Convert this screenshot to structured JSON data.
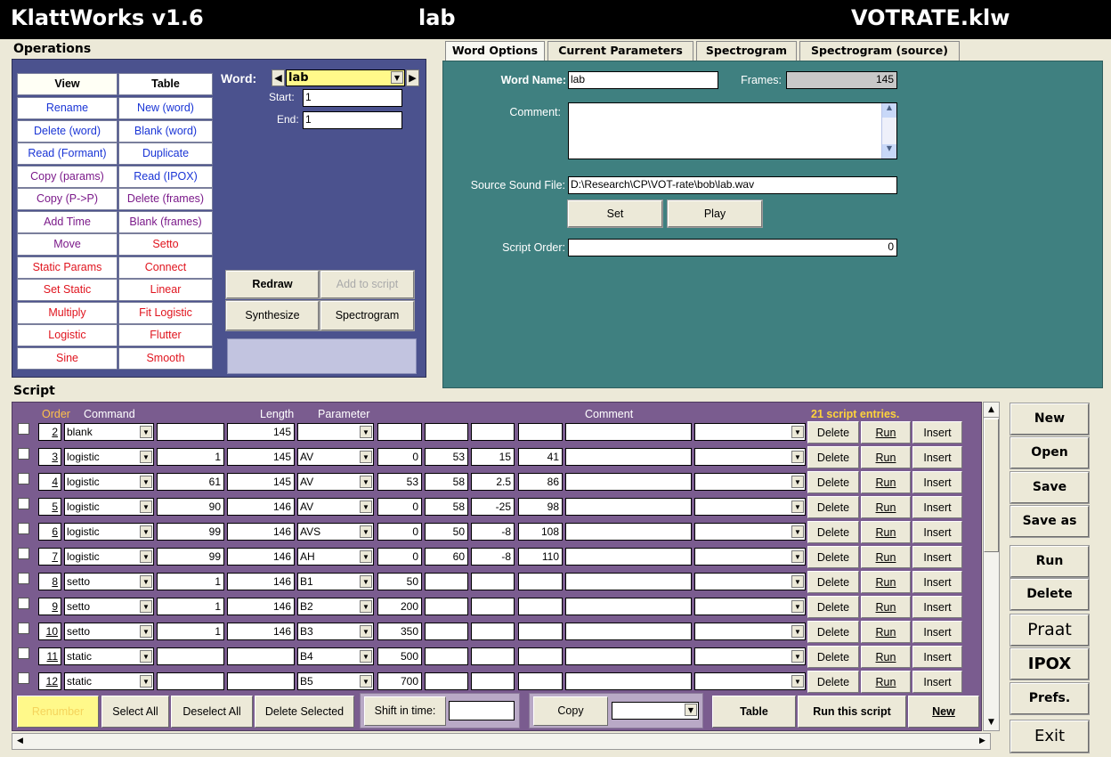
{
  "title": {
    "app": "KlattWorks v1.6",
    "word": "lab",
    "file": "VOTRATE.klw"
  },
  "operations": {
    "heading": "Operations",
    "col_headers": [
      "View",
      "Table"
    ],
    "left_buttons": [
      {
        "label": "Rename",
        "color": "blue"
      },
      {
        "label": "Delete (word)",
        "color": "blue"
      },
      {
        "label": "Read (Formant)",
        "color": "blue"
      },
      {
        "label": "Copy (params)",
        "color": "purple"
      },
      {
        "label": "Copy (P->P)",
        "color": "purple"
      },
      {
        "label": "Add Time",
        "color": "purple"
      },
      {
        "label": "Move",
        "color": "purple"
      },
      {
        "label": "Static Params",
        "color": "red"
      },
      {
        "label": "Set Static",
        "color": "red"
      },
      {
        "label": "Multiply",
        "color": "red"
      },
      {
        "label": "Logistic",
        "color": "red"
      },
      {
        "label": "Sine",
        "color": "red"
      }
    ],
    "right_buttons": [
      {
        "label": "New (word)",
        "color": "blue"
      },
      {
        "label": "Blank (word)",
        "color": "blue"
      },
      {
        "label": "Duplicate",
        "color": "blue"
      },
      {
        "label": "Read (IPOX)",
        "color": "blue"
      },
      {
        "label": "Delete (frames)",
        "color": "purple"
      },
      {
        "label": "Blank (frames)",
        "color": "purple"
      },
      {
        "label": "Setto",
        "color": "red"
      },
      {
        "label": "Connect",
        "color": "red"
      },
      {
        "label": "Linear",
        "color": "red"
      },
      {
        "label": "Fit Logistic",
        "color": "red"
      },
      {
        "label": "Flutter",
        "color": "red"
      },
      {
        "label": "Smooth",
        "color": "red"
      }
    ],
    "word_label": "Word:",
    "word_value": "lab",
    "start_label": "Start:",
    "start_value": "1",
    "end_label": "End:",
    "end_value": "1",
    "redraw": "Redraw",
    "add_to_script": "Add to script",
    "synthesize": "Synthesize",
    "spectrogram": "Spectrogram"
  },
  "tabs": [
    "Word Options",
    "Current Parameters",
    "Spectrogram",
    "Spectrogram (source)"
  ],
  "word_options": {
    "word_name_label": "Word Name:",
    "word_name_value": "lab",
    "frames_label": "Frames:",
    "frames_value": "145",
    "comment_label": "Comment:",
    "comment_value": "",
    "source_label": "Source Sound File:",
    "source_value": "D:\\Research\\CP\\VOT-rate\\bob\\lab.wav",
    "set_label": "Set",
    "play_label": "Play",
    "script_order_label": "Script Order:",
    "script_order_value": "0"
  },
  "script": {
    "heading": "Script",
    "headers": {
      "order": "Order",
      "command": "Command",
      "length": "Length",
      "parameter": "Parameter",
      "comment": "Comment"
    },
    "entries_count": "21 script entries.",
    "row_buttons": {
      "delete": "Delete",
      "run": "Run",
      "insert": "Insert"
    },
    "rows": [
      {
        "order": "2",
        "command": "blank",
        "a": "",
        "length": "145",
        "param": "",
        "v1": "",
        "v2": "",
        "v3": "",
        "v4": ""
      },
      {
        "order": "3",
        "command": "logistic",
        "a": "1",
        "length": "145",
        "param": "AV",
        "v1": "0",
        "v2": "53",
        "v3": "15",
        "v4": "41"
      },
      {
        "order": "4",
        "command": "logistic",
        "a": "61",
        "length": "145",
        "param": "AV",
        "v1": "53",
        "v2": "58",
        "v3": "2.5",
        "v4": "86"
      },
      {
        "order": "5",
        "command": "logistic",
        "a": "90",
        "length": "146",
        "param": "AV",
        "v1": "0",
        "v2": "58",
        "v3": "-25",
        "v4": "98"
      },
      {
        "order": "6",
        "command": "logistic",
        "a": "99",
        "length": "146",
        "param": "AVS",
        "v1": "0",
        "v2": "50",
        "v3": "-8",
        "v4": "108"
      },
      {
        "order": "7",
        "command": "logistic",
        "a": "99",
        "length": "146",
        "param": "AH",
        "v1": "0",
        "v2": "60",
        "v3": "-8",
        "v4": "110"
      },
      {
        "order": "8",
        "command": "setto",
        "a": "1",
        "length": "146",
        "param": "B1",
        "v1": "50",
        "v2": "",
        "v3": "",
        "v4": ""
      },
      {
        "order": "9",
        "command": "setto",
        "a": "1",
        "length": "146",
        "param": "B2",
        "v1": "200",
        "v2": "",
        "v3": "",
        "v4": ""
      },
      {
        "order": "10",
        "command": "setto",
        "a": "1",
        "length": "146",
        "param": "B3",
        "v1": "350",
        "v2": "",
        "v3": "",
        "v4": ""
      },
      {
        "order": "11",
        "command": "static",
        "a": "",
        "length": "",
        "param": "B4",
        "v1": "500",
        "v2": "",
        "v3": "",
        "v4": ""
      },
      {
        "order": "12",
        "command": "static",
        "a": "",
        "length": "",
        "param": "B5",
        "v1": "700",
        "v2": "",
        "v3": "",
        "v4": ""
      }
    ],
    "bottom": {
      "renumber": "Renumber",
      "select_all": "Select All",
      "deselect_all": "Deselect All",
      "delete_selected": "Delete Selected",
      "shift_label": "Shift in time:",
      "shift_value": "",
      "copy": "Copy",
      "table": "Table",
      "run_this": "Run this script",
      "new": "New"
    }
  },
  "right_buttons": [
    "New",
    "Open",
    "Save",
    "Save as",
    "Run",
    "Delete",
    "Praat",
    "IPOX",
    "Prefs.",
    "Exit"
  ],
  "colors": {
    "ops_bg": "#4b528e",
    "word_options_bg": "#3f8080",
    "script_bg": "#7a5c8f",
    "word_select_bg": "#fff98a",
    "entries_text": "#ffd43a"
  }
}
